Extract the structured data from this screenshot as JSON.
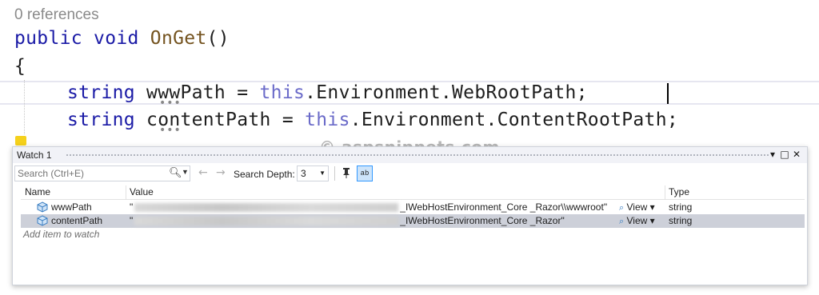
{
  "editor": {
    "references": "0 references",
    "line1": {
      "kw1": "public",
      "kw2": "void",
      "method": "OnGet",
      "paren": "()"
    },
    "line2": "{",
    "line3": {
      "type": "string",
      "var": "wwwPath",
      "eq": " = ",
      "this": "this",
      "rest": ".Environment.WebRootPath;"
    },
    "line4": {
      "type": "string",
      "var": "contentPath",
      "eq": " = ",
      "this": "this",
      "rest": ".Environment.ContentRootPath;"
    },
    "dots": "•••"
  },
  "watermark": "© aspsnippets.com",
  "watch": {
    "title": "Watch 1",
    "title_buttons": {
      "dropdown": "▾",
      "maximize": "□",
      "close": "✕"
    },
    "search_placeholder": "Search (Ctrl+E)",
    "search_depth_label": "Search Depth:",
    "search_depth_value": "3",
    "columns": {
      "name": "Name",
      "value": "Value",
      "type": "Type"
    },
    "rows": [
      {
        "name": "wwwPath",
        "value_prefix": "\"",
        "value_suffix": "_IWebHostEnvironment_Core _Razor\\\\wwwroot\"",
        "view": "View",
        "type": "string"
      },
      {
        "name": "contentPath",
        "value_prefix": "\"",
        "value_suffix": "_IWebHostEnvironment_Core _Razor\"",
        "view": "View",
        "type": "string"
      }
    ],
    "add_item": "Add item to watch"
  },
  "colors": {
    "keyword": "#1a1aa6",
    "method": "#74531f",
    "selection": "#cdd0d9",
    "accent": "#3399ff"
  },
  "icons": [
    "search-icon",
    "back-arrow-icon",
    "forward-arrow-icon",
    "pin-icon",
    "hex-display-icon",
    "object-icon",
    "magnifier-icon",
    "close-icon",
    "maximize-icon"
  ]
}
